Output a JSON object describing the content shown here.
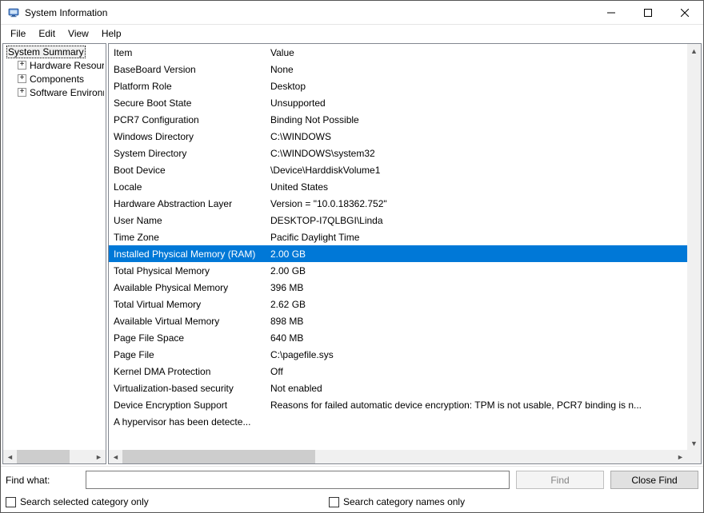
{
  "window": {
    "title": "System Information"
  },
  "menus": {
    "file": "File",
    "edit": "Edit",
    "view": "View",
    "help": "Help"
  },
  "tree": {
    "root": "System Summary",
    "children": [
      "Hardware Resources",
      "Components",
      "Software Environment"
    ]
  },
  "columns": {
    "item": "Item",
    "value": "Value"
  },
  "rows": [
    {
      "item": "BaseBoard Version",
      "value": "None"
    },
    {
      "item": "Platform Role",
      "value": "Desktop"
    },
    {
      "item": "Secure Boot State",
      "value": "Unsupported"
    },
    {
      "item": "PCR7 Configuration",
      "value": "Binding Not Possible"
    },
    {
      "item": "Windows Directory",
      "value": "C:\\WINDOWS"
    },
    {
      "item": "System Directory",
      "value": "C:\\WINDOWS\\system32"
    },
    {
      "item": "Boot Device",
      "value": "\\Device\\HarddiskVolume1"
    },
    {
      "item": "Locale",
      "value": "United States"
    },
    {
      "item": "Hardware Abstraction Layer",
      "value": "Version = \"10.0.18362.752\""
    },
    {
      "item": "User Name",
      "value": "DESKTOP-I7QLBGI\\Linda"
    },
    {
      "item": "Time Zone",
      "value": "Pacific Daylight Time"
    },
    {
      "item": "Installed Physical Memory (RAM)",
      "value": "2.00 GB",
      "selected": true
    },
    {
      "item": "Total Physical Memory",
      "value": "2.00 GB"
    },
    {
      "item": "Available Physical Memory",
      "value": "396 MB"
    },
    {
      "item": "Total Virtual Memory",
      "value": "2.62 GB"
    },
    {
      "item": "Available Virtual Memory",
      "value": "898 MB"
    },
    {
      "item": "Page File Space",
      "value": "640 MB"
    },
    {
      "item": "Page File",
      "value": "C:\\pagefile.sys"
    },
    {
      "item": "Kernel DMA Protection",
      "value": "Off"
    },
    {
      "item": "Virtualization-based security",
      "value": "Not enabled"
    },
    {
      "item": "Device Encryption Support",
      "value": "Reasons for failed automatic device encryption: TPM is not usable, PCR7 binding is n..."
    },
    {
      "item": "A hypervisor has been detecte...",
      "value": ""
    }
  ],
  "search": {
    "label": "Find what:",
    "find": "Find",
    "close": "Close Find",
    "selected_only": "Search selected category only",
    "names_only": "Search category names only"
  }
}
